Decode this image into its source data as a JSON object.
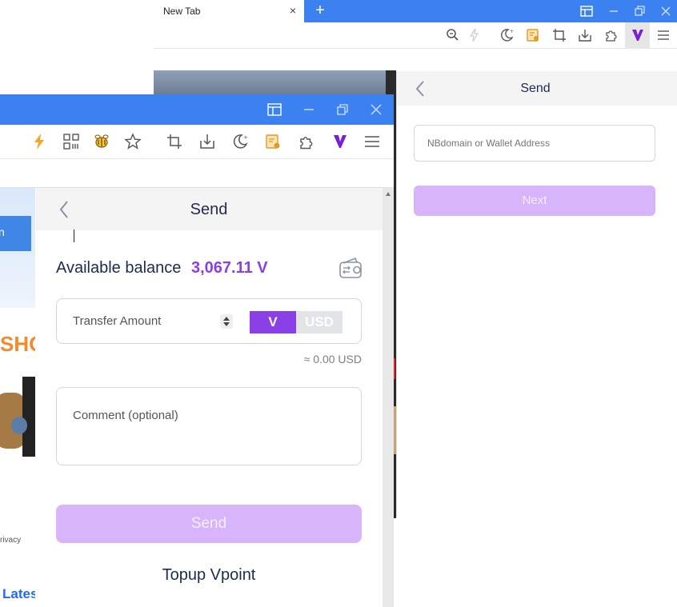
{
  "back_window": {
    "tab_title": "New Tab",
    "tab_close": "×",
    "new_tab": "+",
    "popup": {
      "back": "‹",
      "title": "Send",
      "address_placeholder": "NBdomain or Wallet Address",
      "next_label": "Next"
    }
  },
  "front_window": {
    "page_fragments": {
      "sho": "SHO",
      "privacy": "rivacy",
      "latest": "Lates"
    },
    "popup": {
      "back": "‹",
      "title": "Send",
      "balance_label": "Available balance",
      "balance_value": "3,067.11 V",
      "amount_placeholder": "Transfer Amount",
      "currency_v": "V",
      "currency_usd": "USD",
      "approx": "≈ 0.00 USD",
      "comment_placeholder": "Comment (optional)",
      "send_label": "Send",
      "topup_label": "Topup Vpoint"
    }
  },
  "colors": {
    "titlebar_blue": "#3b82f0",
    "accent_purple": "#8b3fe6",
    "disabled_button": "#d8b4fa"
  }
}
